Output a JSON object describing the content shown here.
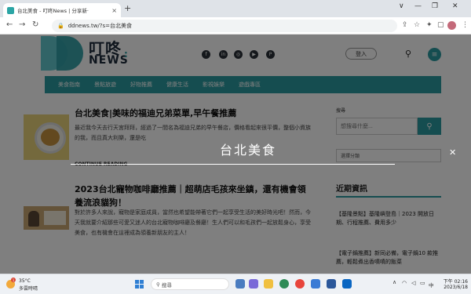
{
  "browser": {
    "tab_title": "台北美食 - 叮咚News | 分享新·",
    "tab_close": "×",
    "new_tab": "+",
    "url": "ddnews.tw/?s=台北美食",
    "window_controls": [
      "∨",
      "—",
      "❐",
      "✕"
    ],
    "icons": [
      "back-icon",
      "forward-icon",
      "reload-icon",
      "lock-icon",
      "share-icon",
      "star-icon",
      "extensions-icon",
      "sidebar-icon",
      "menu-icon"
    ]
  },
  "site": {
    "logo_name": "叮咚",
    "logo_sub": "NEWS",
    "logo_dots": ":",
    "social": [
      "f",
      "in",
      "◎",
      "▶",
      "P"
    ],
    "login_label": "登入",
    "nav_items": [
      "美食指南",
      "景點旅遊",
      "好物推薦",
      "健康生活",
      "影視娛樂",
      "遊戲專區"
    ],
    "accent": "#2a9aa0"
  },
  "articles": [
    {
      "title": "台北美食|美味的福迪兄弟菜單,早午餐推薦",
      "excerpt": "最近我今天去行天宮拜拜，經過了一間名為福迪兄弟的早午餐店，價格看起來很平價，整個小資族的我，而且真大利樂，還是吃",
      "read_more": "CONTINUE READING"
    },
    {
      "title": "2023台北寵物咖啡廳推薦｜超萌店毛孩來坐鎮，還有機會領養流浪貓狗！",
      "excerpt": "對於許多人來說，寵物是家庭成員，當然也希望能帶著它們一起享受生活的美好時光吧！然而，今天我就要介紹那些可愛又迷人的台北寵物咖啡廳及餐廳！生人們可以和毛孩們一起放鬆身心，享受美食，也有機會在這裡成為領養新朋友的主人！"
    }
  ],
  "sidebar": {
    "search_label": "搜尋",
    "search_placeholder": "想搜尋什麼...",
    "search_icon": "search-icon",
    "category_select": "選擇分類",
    "recent_heading": "近期資訊",
    "recent_items": [
      "【基隆景點】基隆嶼登島｜2023 開放日期、行程推薦、費用多少",
      "【電子鍋推薦】新同必備，電子鍋10 款推薦，輕鬆煮出香噴噴的飯菜"
    ]
  },
  "overlay": {
    "query": "台北美食",
    "close": "✕"
  },
  "taskbar": {
    "temperature": "35°C",
    "condition": "多雲時晴",
    "weather_badge": "1",
    "search_label": "搜尋",
    "lang": "中",
    "time": "下午 02:16",
    "date": "2023/6/18"
  }
}
